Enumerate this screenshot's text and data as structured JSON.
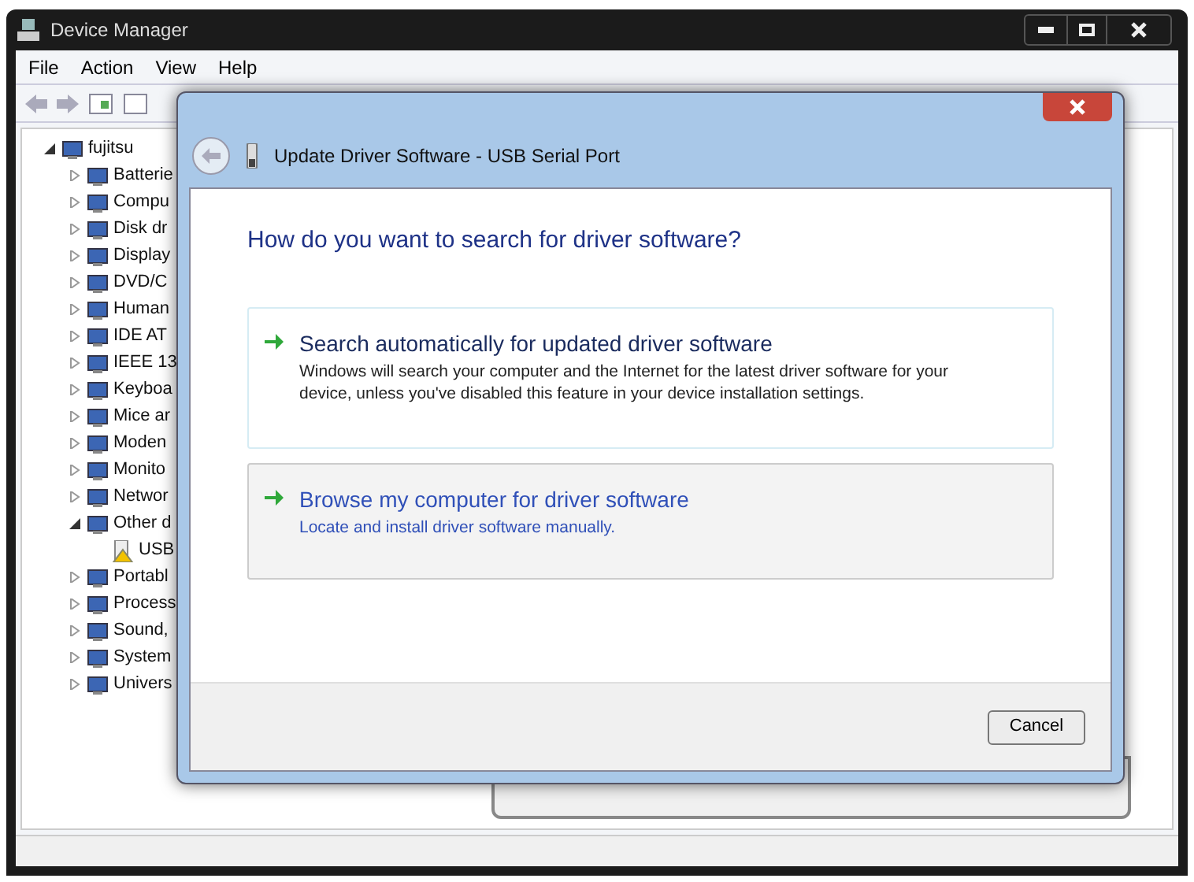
{
  "window": {
    "title": "Device Manager"
  },
  "menu": [
    "File",
    "Action",
    "View",
    "Help"
  ],
  "tree": [
    {
      "label": "fujitsu",
      "expanded": true,
      "children": [
        {
          "label": "Batterie",
          "expanded": false
        },
        {
          "label": "Compu",
          "expanded": false
        },
        {
          "label": "Disk dr",
          "expanded": false
        },
        {
          "label": "Display",
          "expanded": false
        },
        {
          "label": "DVD/C",
          "expanded": false
        },
        {
          "label": "Human",
          "expanded": false
        },
        {
          "label": "IDE AT",
          "expanded": false
        },
        {
          "label": "IEEE 13",
          "expanded": false
        },
        {
          "label": "Keyboa",
          "expanded": false
        },
        {
          "label": "Mice ar",
          "expanded": false
        },
        {
          "label": "Moden",
          "expanded": false
        },
        {
          "label": "Monito",
          "expanded": false
        },
        {
          "label": "Networ",
          "expanded": false
        },
        {
          "label": "Other d",
          "expanded": true,
          "children": [
            {
              "label": "USB",
              "warning": true
            }
          ]
        },
        {
          "label": "Portabl",
          "expanded": false
        },
        {
          "label": "Process",
          "expanded": false
        },
        {
          "label": "Sound,",
          "expanded": false
        },
        {
          "label": "System",
          "expanded": false
        },
        {
          "label": "Univers",
          "expanded": false
        }
      ]
    }
  ],
  "dialog": {
    "title": "Update Driver Software - USB Serial Port",
    "heading": "How do you want to search for driver software?",
    "options": [
      {
        "title": "Search automatically for updated driver software",
        "description": "Windows will search your computer and the Internet for the latest driver software for your device, unless you've disabled this feature in your device installation settings.",
        "selected": false
      },
      {
        "title": "Browse my computer for driver software",
        "description": "Locate and install driver software manually.",
        "selected": true
      }
    ],
    "buttons": [
      "Cancel"
    ]
  }
}
